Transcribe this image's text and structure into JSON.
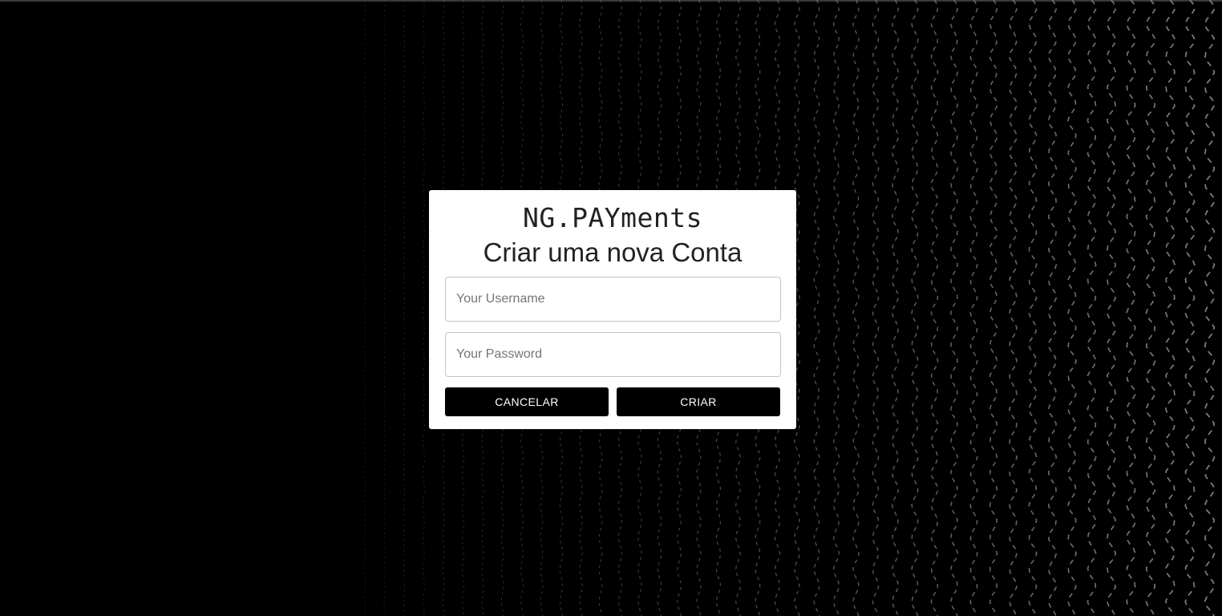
{
  "app": {
    "brand": "NG.PAYments",
    "subtitle": "Criar uma nova Conta"
  },
  "form": {
    "username": {
      "value": "",
      "placeholder": "Your Username"
    },
    "password": {
      "value": "",
      "placeholder": "Your Password"
    }
  },
  "actions": {
    "cancel_label": "CANCELAR",
    "create_label": "CRIAR"
  },
  "theme": {
    "background": "#000000",
    "card": "#ffffff",
    "button": "#000000",
    "button_text": "#ffffff",
    "wave_pattern": "#8a8a8a"
  }
}
